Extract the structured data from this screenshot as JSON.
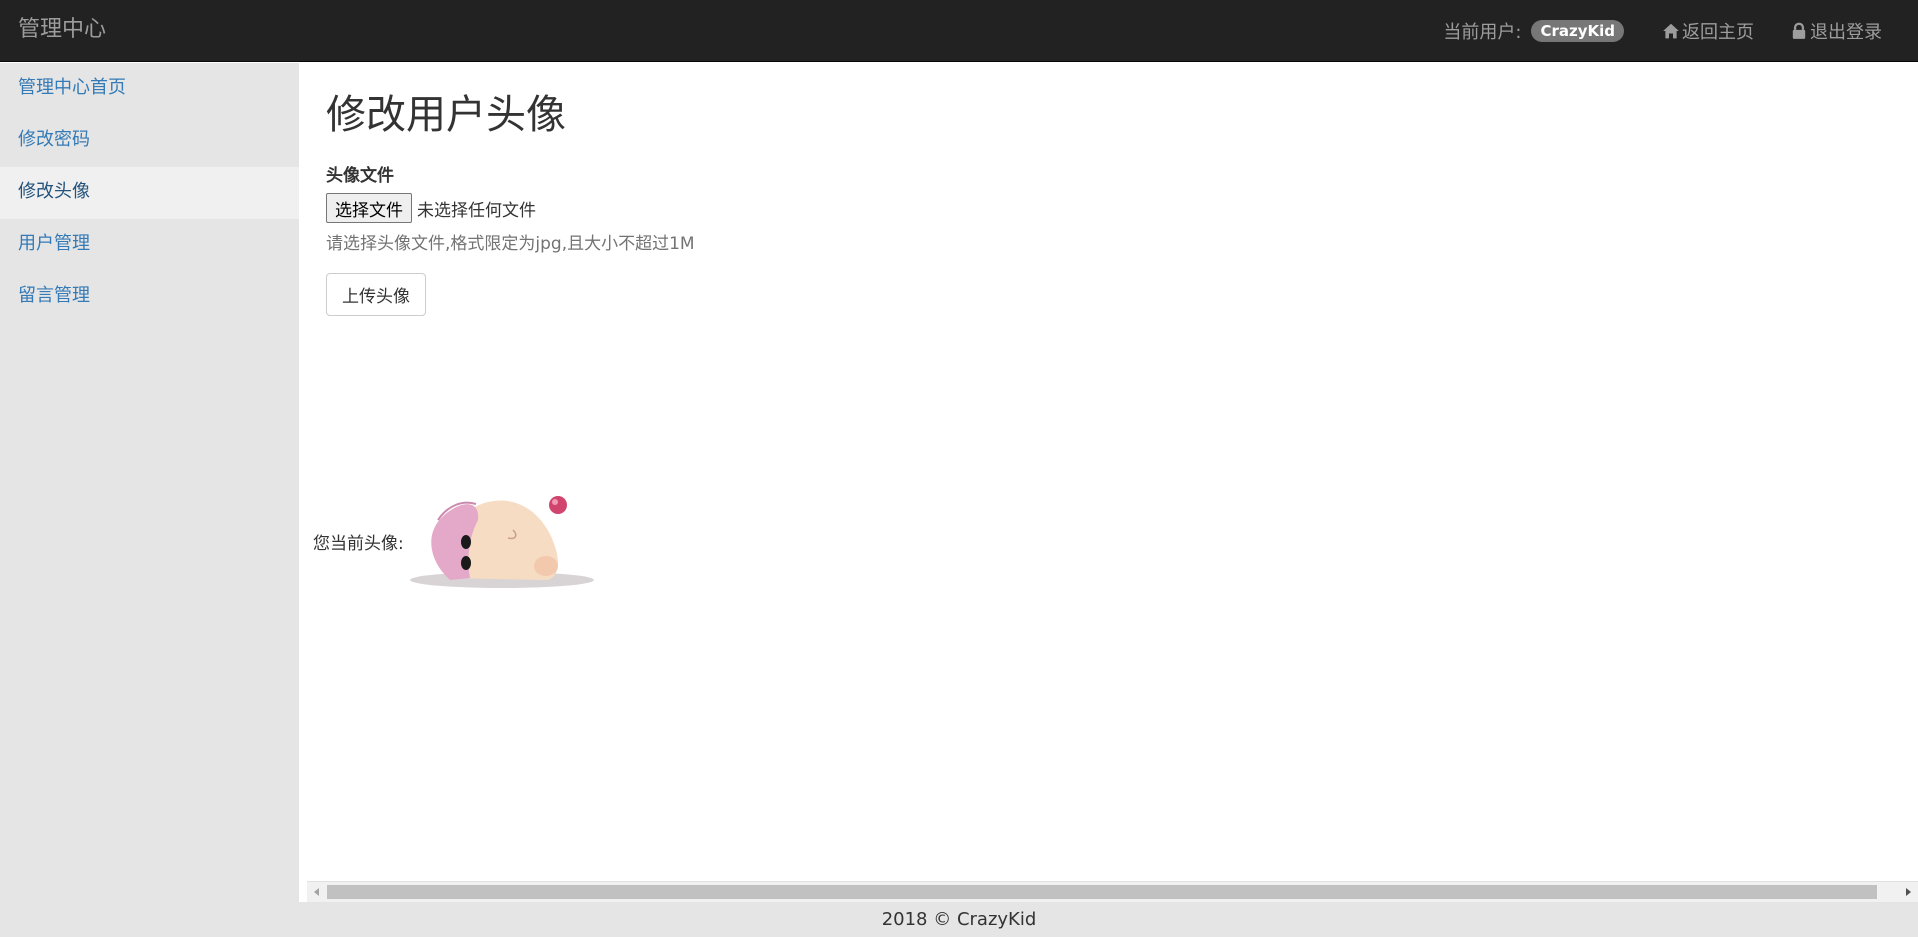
{
  "navbar": {
    "brand": "管理中心",
    "current_user_label": "当前用户:",
    "username": "CrazyKid",
    "home_link": "返回主页",
    "logout_link": "退出登录"
  },
  "sidebar": {
    "items": [
      {
        "label": "管理中心首页"
      },
      {
        "label": "修改密码"
      },
      {
        "label": "修改头像"
      },
      {
        "label": "用户管理"
      },
      {
        "label": "留言管理"
      }
    ]
  },
  "main": {
    "title": "修改用户头像",
    "file_field_label": "头像文件",
    "choose_file_button": "选择文件",
    "no_file_text": "未选择任何文件",
    "help_text": "请选择头像文件,格式限定为jpg,且大小不超过1M",
    "upload_button": "上传头像",
    "current_avatar_label": "您当前头像:"
  },
  "footer": {
    "text": "2018 © CrazyKid"
  },
  "colors": {
    "navbar_bg": "#222222",
    "sidebar_bg": "#e5e5e5",
    "link": "#337ab7",
    "badge_bg": "#777777"
  }
}
